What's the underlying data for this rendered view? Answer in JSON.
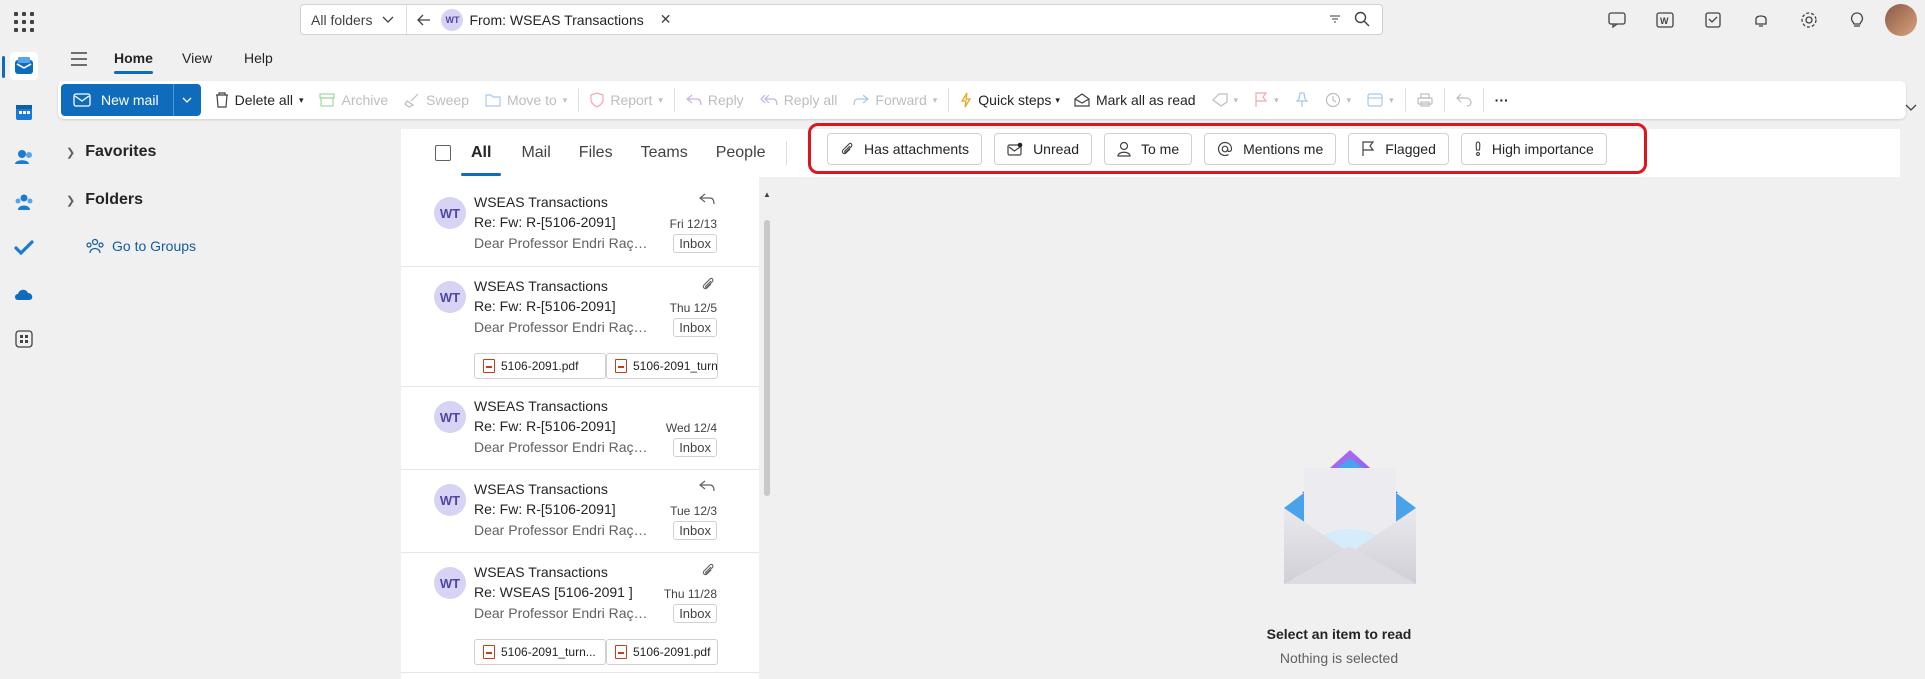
{
  "search": {
    "scope": "All folders",
    "chip_initials": "WT",
    "chip_label": "From: WSEAS Transactions"
  },
  "ribbon": {
    "tabs": [
      "Home",
      "View",
      "Help"
    ]
  },
  "toolbar": {
    "new_mail": "New mail",
    "delete_all": "Delete all",
    "archive": "Archive",
    "sweep": "Sweep",
    "move_to": "Move to",
    "report": "Report",
    "reply": "Reply",
    "reply_all": "Reply all",
    "forward": "Forward",
    "quick_steps": "Quick steps",
    "mark_all_read": "Mark all as read",
    "more": "···"
  },
  "folder_pane": {
    "favorites": "Favorites",
    "folders": "Folders",
    "go_to_groups": "Go to Groups"
  },
  "pivots": [
    "All",
    "Mail",
    "Files",
    "Teams",
    "People"
  ],
  "filter_chips": [
    "Has attachments",
    "Unread",
    "To me",
    "Mentions me",
    "Flagged",
    "High importance"
  ],
  "messages": [
    {
      "initials": "WT",
      "sender": "WSEAS Transactions",
      "subject": "Re: Fw: R-[5106-2091]",
      "preview": "Dear Professor Endri Raço, ...",
      "date": "Fri 12/13",
      "folder": "Inbox",
      "status": "reply-icon",
      "attachments": []
    },
    {
      "initials": "WT",
      "sender": "WSEAS Transactions",
      "subject": "Re: Fw: R-[5106-2091]",
      "preview": "Dear Professor Endri Raço, ...",
      "date": "Thu 12/5",
      "folder": "Inbox",
      "status": "paperclip-icon",
      "attachments": [
        "5106-2091.pdf",
        "5106-2091_turn"
      ]
    },
    {
      "initials": "WT",
      "sender": "WSEAS Transactions",
      "subject": "Re: Fw: R-[5106-2091]",
      "preview": "Dear Professor Endri Raço, ...",
      "date": "Wed 12/4",
      "folder": "Inbox",
      "status": "",
      "attachments": []
    },
    {
      "initials": "WT",
      "sender": "WSEAS Transactions",
      "subject": "Re: Fw: R-[5106-2091]",
      "preview": "Dear Professor Endri Raço, ...",
      "date": "Tue 12/3",
      "folder": "Inbox",
      "status": "reply-icon",
      "attachments": []
    },
    {
      "initials": "WT",
      "sender": "WSEAS Transactions",
      "subject": "Re: WSEAS [5106-2091 ]",
      "preview": "Dear Professor Endri Raço, ...",
      "date": "Thu 11/28",
      "folder": "Inbox",
      "status": "paperclip-icon",
      "attachments": [
        "5106-2091_turn...",
        "5106-2091.pdf"
      ]
    }
  ],
  "reading_pane": {
    "title": "Select an item to read",
    "subtitle": "Nothing is selected"
  },
  "colors": {
    "accent": "#0f6cbd",
    "highlight_box": "#e0141e",
    "avatar_bg": "#d6d3f5"
  }
}
